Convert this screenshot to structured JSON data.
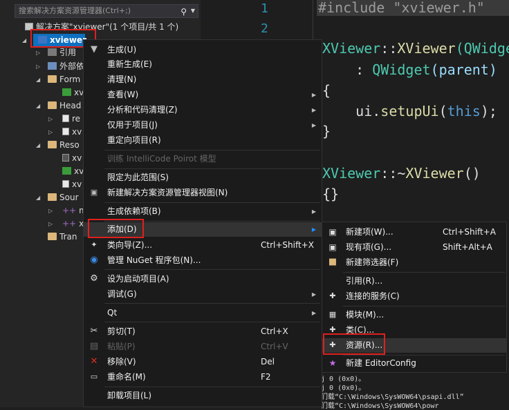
{
  "explorer": {
    "search_placeholder": "搜索解决方案资源管理器(Ctrl+;)",
    "solution_label": "解决方案\"xviewer\"(1 个项目/共 1 个)",
    "project_label": "xviewer",
    "nodes": [
      "引用",
      "外部依",
      "Form",
      "xv",
      "Head",
      "re",
      "xv",
      "Reso",
      "xv",
      "xv",
      "xv",
      "Sour",
      "m",
      "xv",
      "Tran"
    ]
  },
  "editor": {
    "line_numbers": [
      "1",
      "2"
    ],
    "lines": {
      "l1": "#include \"xviewer.h\"",
      "l3a": "XViewer",
      "l3b": "::",
      "l3c": "XViewer",
      "l3d": "(QWidge",
      "l4a": "    : ",
      "l4b": "QWidget",
      "l4c": "(parent)",
      "l5": "{",
      "l6a": "    ui.",
      "l6b": "setupUi",
      "l6c": "(",
      "l6d": "this",
      "l6e": ");",
      "l7": "}",
      "l9a": "XViewer",
      "l9b": "::~",
      "l9c": "XViewer",
      "l9d": "()",
      "l10": "{}"
    }
  },
  "output": {
    "lines": [
      "j 0 (0x0)。",
      "j 0 (0x0)。",
      "们载“C:\\Windows\\SysWOW64\\psapi.dll”",
      "们载“C:\\Windows\\SysWOW64\\powr"
    ]
  },
  "context_menu": {
    "items": [
      {
        "label": "生成(U)",
        "shortcut": ""
      },
      {
        "label": "重新生成(E)",
        "shortcut": ""
      },
      {
        "label": "清理(N)",
        "shortcut": ""
      },
      {
        "label": "查看(W)",
        "shortcut": ""
      },
      {
        "label": "分析和代码清理(Z)",
        "shortcut": ""
      },
      {
        "label": "仅用于项目(J)",
        "shortcut": ""
      },
      {
        "label": "重定向项目(R)",
        "shortcut": ""
      },
      {
        "label": "训练 IntelliCode Poirot 模型",
        "shortcut": ""
      },
      {
        "label": "限定为此范围(S)",
        "shortcut": ""
      },
      {
        "label": "新建解决方案资源管理器视图(N)",
        "shortcut": ""
      },
      {
        "label": "生成依赖项(B)",
        "shortcut": ""
      },
      {
        "label": "添加(D)",
        "shortcut": ""
      },
      {
        "label": "类向导(Z)...",
        "shortcut": "Ctrl+Shift+X"
      },
      {
        "label": "管理 NuGet 程序包(N)...",
        "shortcut": ""
      },
      {
        "label": "设为启动项目(A)",
        "shortcut": ""
      },
      {
        "label": "调试(G)",
        "shortcut": ""
      },
      {
        "label": "Qt",
        "shortcut": ""
      },
      {
        "label": "剪切(T)",
        "shortcut": "Ctrl+X"
      },
      {
        "label": "粘贴(P)",
        "shortcut": "Ctrl+V"
      },
      {
        "label": "移除(V)",
        "shortcut": "Del"
      },
      {
        "label": "重命名(M)",
        "shortcut": "F2"
      },
      {
        "label": "卸载项目(L)",
        "shortcut": ""
      }
    ]
  },
  "add_submenu": {
    "items": [
      {
        "label": "新建项(W)...",
        "shortcut": "Ctrl+Shift+A"
      },
      {
        "label": "现有项(G)...",
        "shortcut": "Shift+Alt+A"
      },
      {
        "label": "新建筛选器(F)",
        "shortcut": ""
      },
      {
        "label": "引用(R)...",
        "shortcut": ""
      },
      {
        "label": "连接的服务(C)",
        "shortcut": ""
      },
      {
        "label": "模块(M)...",
        "shortcut": ""
      },
      {
        "label": "类(C)...",
        "shortcut": ""
      },
      {
        "label": "资源(R)...",
        "shortcut": ""
      },
      {
        "label": "新建 EditorConfig",
        "shortcut": ""
      }
    ]
  },
  "colors": {
    "accent_selection": "#0e70c0",
    "highlight_box": "#e0201d",
    "editor_bg": "#1e1e1e",
    "menu_bg": "#1b1b1c"
  }
}
